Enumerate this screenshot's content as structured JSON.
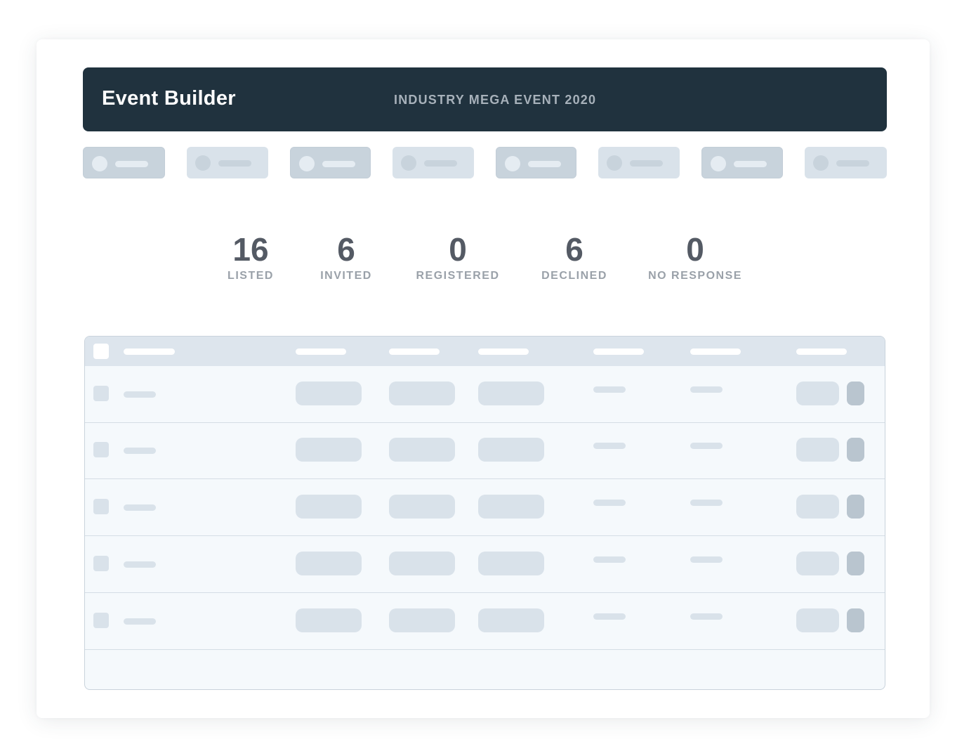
{
  "header": {
    "app_title": "Event Builder",
    "event_name": "INDUSTRY MEGA EVENT 2020",
    "background_color": "#20323e"
  },
  "tabs": [
    {
      "style": "dark"
    },
    {
      "style": "light"
    },
    {
      "style": "dark"
    },
    {
      "style": "light"
    },
    {
      "style": "dark"
    },
    {
      "style": "light"
    },
    {
      "style": "dark"
    },
    {
      "style": "light"
    }
  ],
  "stats": [
    {
      "value": "16",
      "label": "LISTED"
    },
    {
      "value": "6",
      "label": "INVITED"
    },
    {
      "value": "0",
      "label": "REGISTERED"
    },
    {
      "value": "6",
      "label": "DECLINED"
    },
    {
      "value": "0",
      "label": "NO RESPONSE"
    }
  ],
  "table": {
    "row_count": 5
  },
  "colors": {
    "placeholder": "#d9e2ea",
    "placeholder_dark": "#b9c5cf",
    "stat_number": "#545a64",
    "stat_label": "#9aa1a9"
  }
}
